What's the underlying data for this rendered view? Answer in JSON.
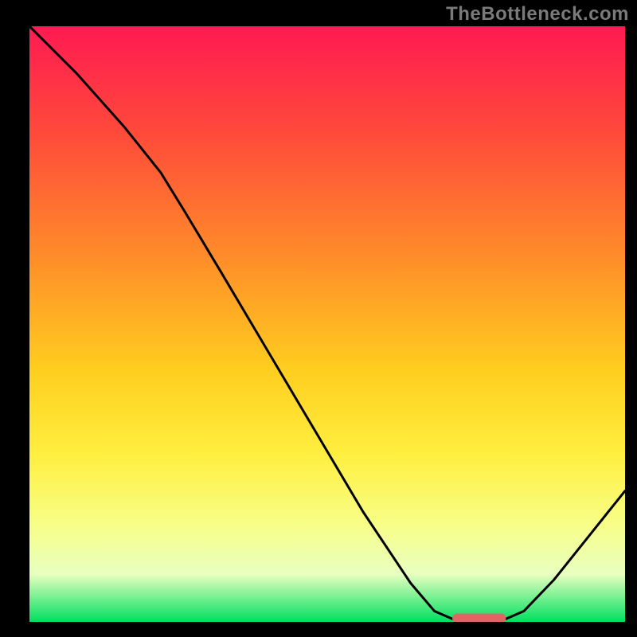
{
  "watermark": "TheBottleneck.com",
  "chart_data": {
    "type": "line",
    "title": "",
    "xlabel": "",
    "ylabel": "",
    "xlim": [
      0,
      100
    ],
    "ylim": [
      0,
      100
    ],
    "grid": false,
    "gradient_stops": [
      {
        "offset": 0.0,
        "color": "#ff1a52"
      },
      {
        "offset": 0.18,
        "color": "#ff4a3a"
      },
      {
        "offset": 0.38,
        "color": "#ff8a2a"
      },
      {
        "offset": 0.58,
        "color": "#ffcf1f"
      },
      {
        "offset": 0.72,
        "color": "#ffef40"
      },
      {
        "offset": 0.84,
        "color": "#f7ff8a"
      },
      {
        "offset": 0.92,
        "color": "#e8ffc0"
      },
      {
        "offset": 1.0,
        "color": "#00e060"
      }
    ],
    "series": [
      {
        "name": "curve",
        "points": [
          {
            "x": 0,
            "y": 100.0
          },
          {
            "x": 8,
            "y": 92.0
          },
          {
            "x": 16,
            "y": 83.0
          },
          {
            "x": 22,
            "y": 75.5
          },
          {
            "x": 26,
            "y": 69.0
          },
          {
            "x": 32,
            "y": 59.0
          },
          {
            "x": 40,
            "y": 45.5
          },
          {
            "x": 48,
            "y": 32.0
          },
          {
            "x": 56,
            "y": 18.5
          },
          {
            "x": 64,
            "y": 6.5
          },
          {
            "x": 68,
            "y": 1.8
          },
          {
            "x": 71,
            "y": 0.5
          },
          {
            "x": 80,
            "y": 0.5
          },
          {
            "x": 83,
            "y": 1.8
          },
          {
            "x": 88,
            "y": 7.0
          },
          {
            "x": 94,
            "y": 14.5
          },
          {
            "x": 100,
            "y": 22.0
          }
        ]
      }
    ],
    "marker": {
      "x_start": 71,
      "x_end": 80,
      "y": 0.6,
      "thickness": 1.6
    },
    "colors": {
      "curve": "#000000",
      "marker": "#e06666",
      "frame": "#000000",
      "watermark": "#7a7a7a"
    }
  }
}
